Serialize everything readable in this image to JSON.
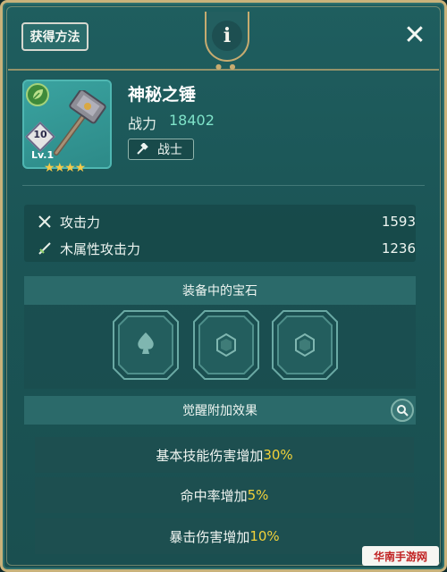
{
  "header": {
    "obtain_label": "获得方法",
    "info_label": "i",
    "close_label": "✕"
  },
  "item": {
    "name": "神秘之锤",
    "power_label": "战力",
    "power_value": "18402",
    "class_label": "战士",
    "level_number": "10",
    "level_text": "Lv.1",
    "stars": "★★★★",
    "element": "leaf-icon"
  },
  "stats": [
    {
      "label": "攻击力",
      "value": "1593",
      "icon": "crossed-swords-icon"
    },
    {
      "label": "木属性攻击力",
      "value": "1236",
      "icon": "sword-icon"
    }
  ],
  "gems_section": {
    "title": "装备中的宝石",
    "slots": [
      "spade-gem-icon",
      "hex-gem-icon",
      "hex-gem-icon"
    ]
  },
  "awaken_section": {
    "title": "觉醒附加效果",
    "effects": [
      {
        "prefix": "基本技能伤害增加",
        "pct": "30%"
      },
      {
        "prefix": "命中率增加",
        "pct": "5%"
      },
      {
        "prefix": "暴击伤害增加",
        "pct": "10%"
      }
    ]
  },
  "watermark": "华南手游网",
  "colors": {
    "frame_gold": "#c9b27a",
    "panel_teal": "#1f5e5f",
    "power_green": "#7fe3c9",
    "highlight_yellow": "#f2d23a"
  }
}
